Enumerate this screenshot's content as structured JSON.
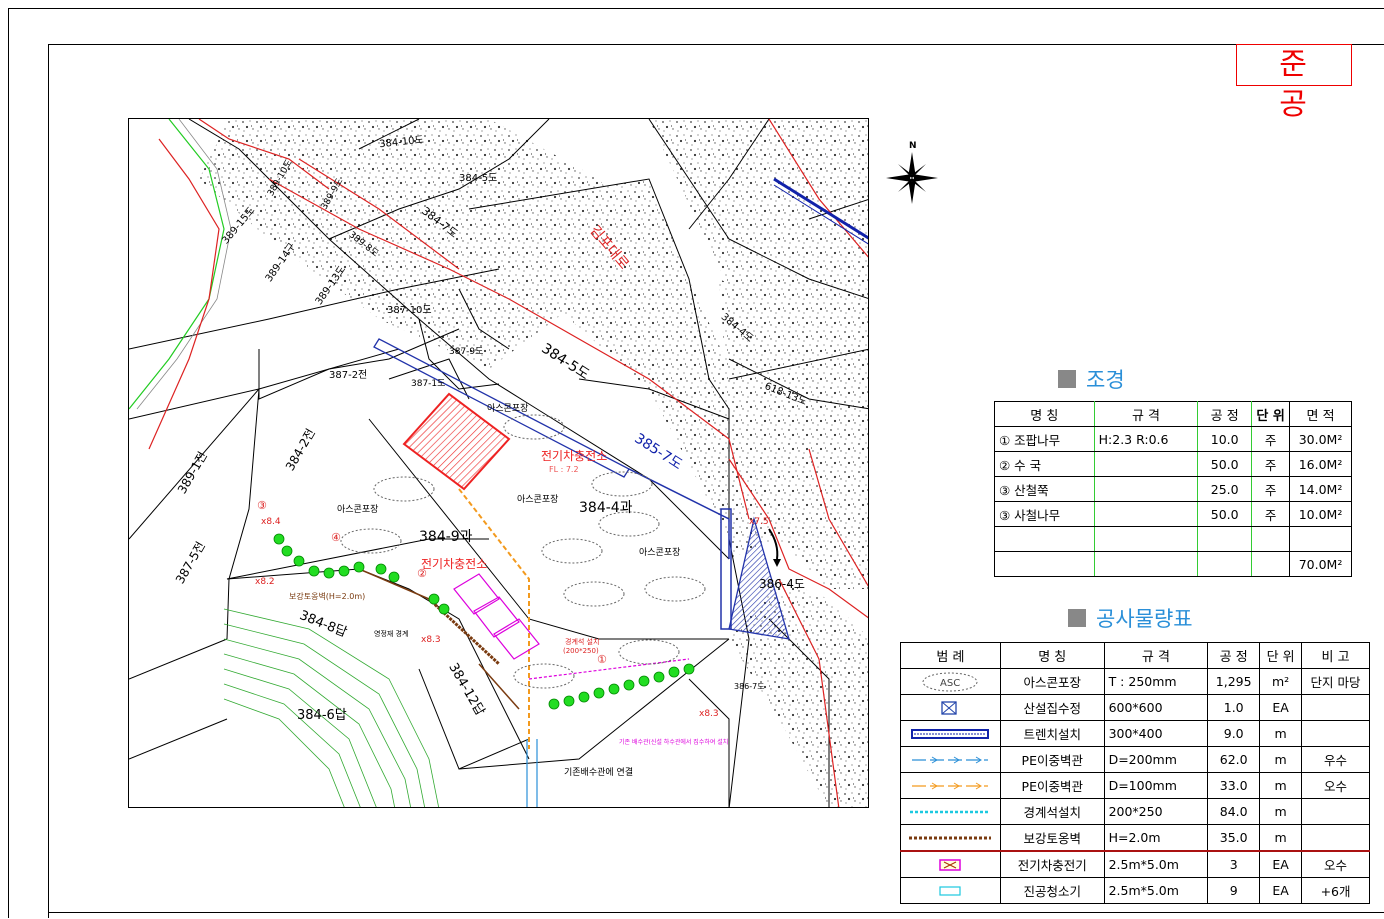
{
  "stamp": "준 공",
  "compass_label": "N",
  "map": {
    "parcels": [
      "384-10도",
      "384-5도",
      "384-7도",
      "389-14구",
      "389-13도",
      "389-9도",
      "389-8도",
      "387-10도",
      "387-9도",
      "387-2전",
      "387-1도",
      "389-1전",
      "384-2전",
      "387-5전",
      "384-8답",
      "384-6답",
      "384-12답",
      "384-9과",
      "384-4과",
      "384-5도",
      "384-4도",
      "618-13도",
      "385-7도",
      "386-4도",
      "386-7도",
      "389-15도",
      "389-10도"
    ],
    "road_label": "김포대로",
    "station_labels": [
      "전기차충전소",
      "전기차충전소"
    ],
    "fl_label": "FL : 7.2",
    "asphalt_labels": [
      "아스콘포장",
      "아스콘포장",
      "아스콘포장",
      "아스콘포장"
    ],
    "asc": "ASC",
    "wall_label": "보강토옹벽(H=2.0m)",
    "boundary_label": "경계석 설치 (200*250)",
    "boundary_short": "경계석 설치",
    "boundary_size": "(200*250)",
    "land_boundary": "영정재 경계",
    "connect_label": "기존배수관에 연결",
    "pipe_note": "기존 배수관(신설 하수관에서 집수하여 설치",
    "elevations": [
      "x8.4",
      "x8.2",
      "x8.3",
      "x8.3",
      "x7.5"
    ],
    "markers": [
      "①",
      "②",
      "③",
      "④"
    ]
  },
  "landscape": {
    "title": "조경",
    "headers": [
      "명 칭",
      "규 격",
      "공 정",
      "단 위",
      "면 적"
    ],
    "rows": [
      {
        "name": "① 조팝나무",
        "spec": "H:2.3  R:0.6",
        "qty": "10.0",
        "unit": "주",
        "area": "30.0M²"
      },
      {
        "name": "②  수 국",
        "spec": "",
        "qty": "50.0",
        "unit": "주",
        "area": "16.0M²"
      },
      {
        "name": "③  산철쭉",
        "spec": "",
        "qty": "25.0",
        "unit": "주",
        "area": "14.0M²"
      },
      {
        "name": "③  사철나무",
        "spec": "",
        "qty": "50.0",
        "unit": "주",
        "area": "10.0M²"
      },
      {
        "name": "",
        "spec": "",
        "qty": "",
        "unit": "",
        "area": ""
      },
      {
        "name": "",
        "spec": "",
        "qty": "",
        "unit": "",
        "area": "70.0M²"
      }
    ]
  },
  "quantities": {
    "title": "공사물량표",
    "headers": [
      "범 례",
      "명 칭",
      "규 격",
      "공 정",
      "단 위",
      "비 고"
    ],
    "rows": [
      {
        "legend": "asc",
        "name": "아스콘포장",
        "spec": "T : 250mm",
        "qty": "1,295",
        "unit": "m²",
        "note": "단지 마당"
      },
      {
        "legend": "catch",
        "name": "산설집수정",
        "spec": "600*600",
        "qty": "1.0",
        "unit": "EA",
        "note": ""
      },
      {
        "legend": "trench",
        "name": "트렌치설치",
        "spec": "300*400",
        "qty": "9.0",
        "unit": "m",
        "note": ""
      },
      {
        "legend": "pe-blue",
        "name": "PE이중벽관",
        "spec": "D=200mm",
        "qty": "62.0",
        "unit": "m",
        "note": "우수"
      },
      {
        "legend": "pe-orange",
        "name": "PE이중벽관",
        "spec": "D=100mm",
        "qty": "33.0",
        "unit": "m",
        "note": "오수"
      },
      {
        "legend": "curb",
        "name": "경계석설치",
        "spec": "200*250",
        "qty": "84.0",
        "unit": "m",
        "note": ""
      },
      {
        "legend": "wall",
        "name": "보강토옹벽",
        "spec": "H=2.0m",
        "qty": "35.0",
        "unit": "m",
        "note": ""
      },
      {
        "legend": "charger",
        "name": "전기차충전기",
        "spec": "2.5m*5.0m",
        "qty": "3",
        "unit": "EA",
        "note": "오수"
      },
      {
        "legend": "vacuum",
        "name": "진공청소기",
        "spec": "2.5m*5.0m",
        "qty": "9",
        "unit": "EA",
        "note": "+6개"
      }
    ]
  }
}
